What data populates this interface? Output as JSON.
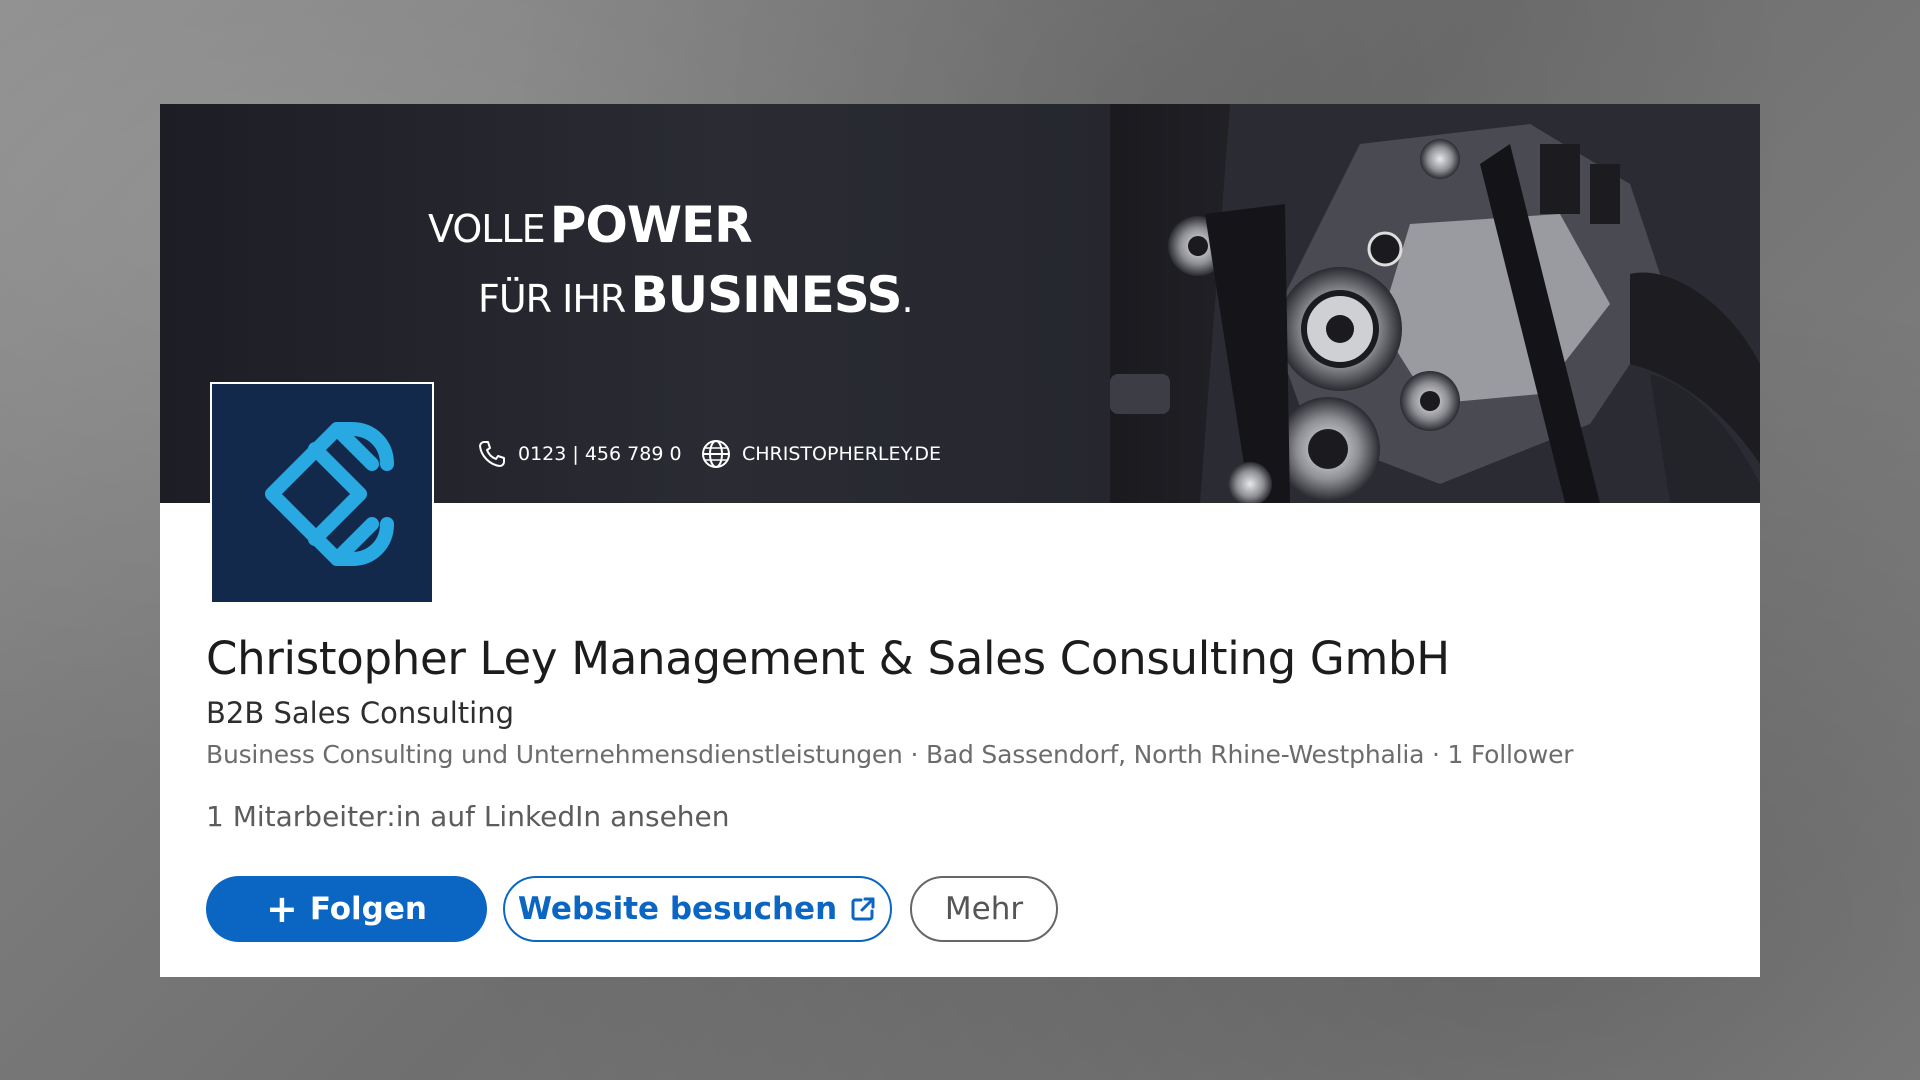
{
  "banner": {
    "slogan_line1_thin": "VOLLE",
    "slogan_line1_bold": "POWER",
    "slogan_line2_thin": "FÜR IHR",
    "slogan_line2_bold": "BUSINESS",
    "slogan_line2_dot": ".",
    "phone": "0123 | 456 789 0",
    "website": "CHRISTOPHERLEY.DE",
    "phone_icon": "phone-icon",
    "globe_icon": "globe-icon"
  },
  "company": {
    "name": "Christopher Ley Management & Sales Consulting GmbH",
    "tagline": "B2B Sales Consulting",
    "meta": "Business Consulting und Unternehmensdienstleistungen · Bad Sassendorf, North Rhine-Westphalia · 1 Follower",
    "employees_link": "1 Mitarbeiter:in auf LinkedIn ansehen"
  },
  "actions": {
    "follow_label": "Folgen",
    "follow_icon_glyph": "+",
    "website_label": "Website besuchen",
    "more_label": "Mehr"
  },
  "colors": {
    "accent": "#0a66c2",
    "logo_bg": "#13294b",
    "logo_mark": "#29a9e1",
    "banner_bg": "#22232a"
  }
}
